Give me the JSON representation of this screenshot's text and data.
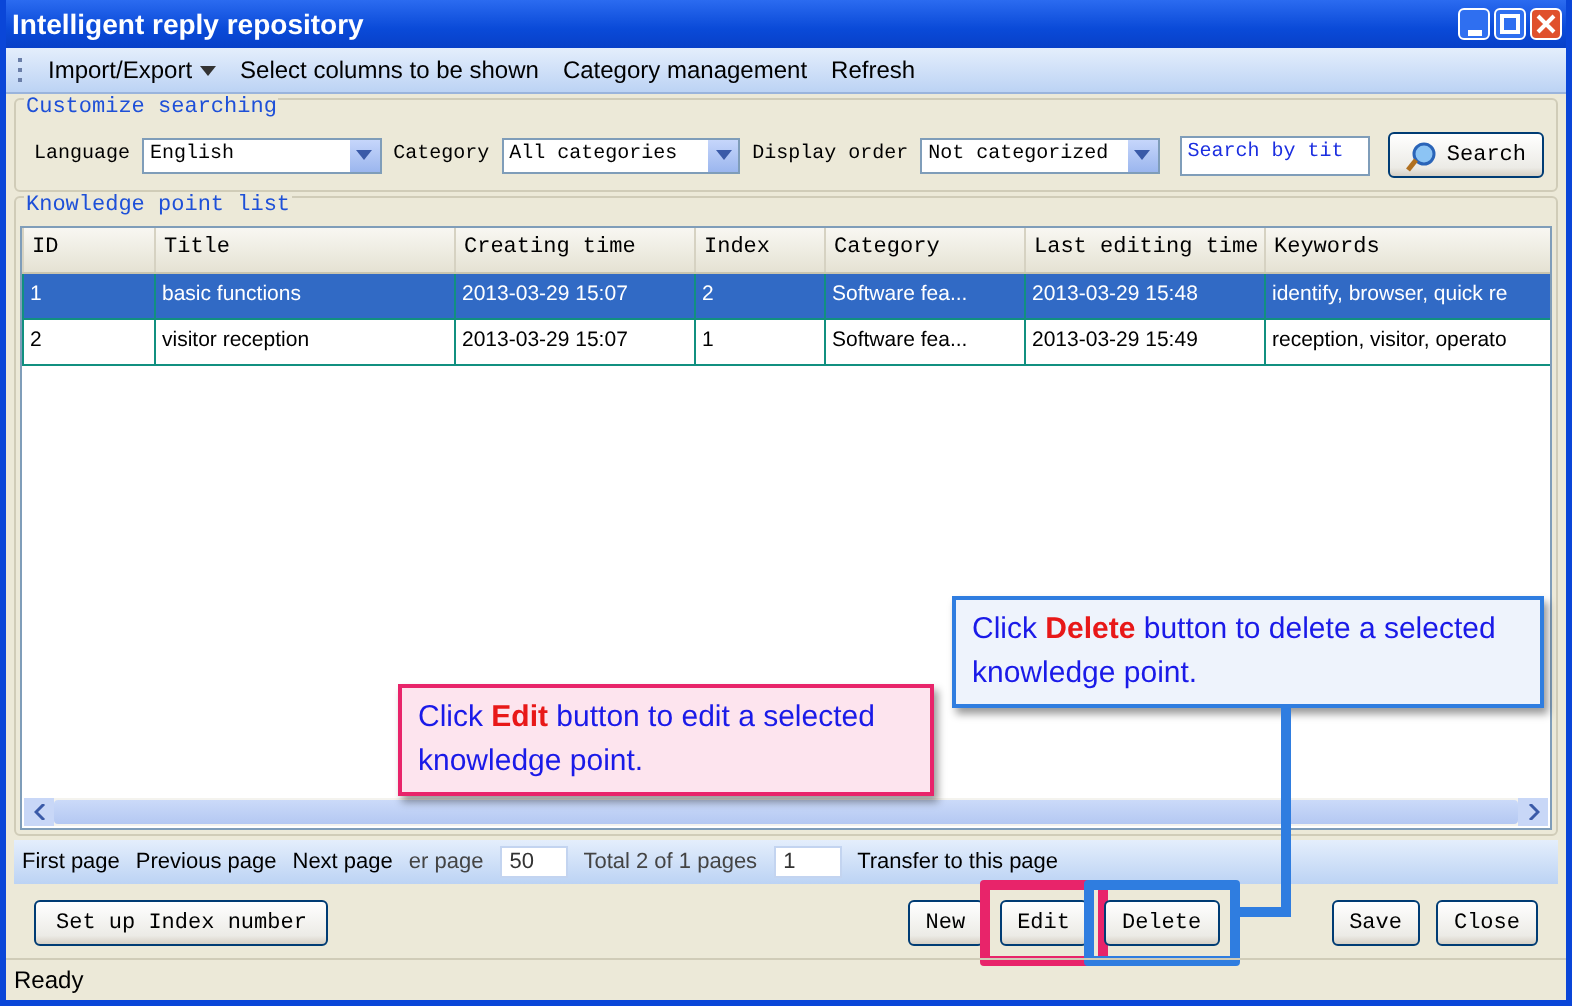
{
  "window": {
    "title": "Intelligent reply repository"
  },
  "toolbar": [
    {
      "label": "Import/Export",
      "kind": "dropdown"
    },
    {
      "label": "Select columns to be shown",
      "kind": "plain"
    },
    {
      "label": "Category management",
      "kind": "plain"
    },
    {
      "label": "Refresh",
      "kind": "plain"
    }
  ],
  "search": {
    "group_title": "Customize searching",
    "filters": [
      {
        "label": "Language",
        "value": "English"
      },
      {
        "label": "Category",
        "value": "All categories"
      },
      {
        "label": "Display order",
        "value": "Not categorized"
      }
    ],
    "query": {
      "value": "Search by tit"
    },
    "button": "Search"
  },
  "list": {
    "group_title": "Knowledge point list",
    "columns": [
      "ID",
      "Title",
      "Creating time",
      "Index",
      "Category",
      "Last editing time",
      "Keywords"
    ],
    "rows": [
      {
        "selected": true,
        "cells": [
          "1",
          "basic functions",
          "2013-03-29 15:07",
          "2",
          "Software fea...",
          "2013-03-29 15:48",
          "identify, browser, quick re"
        ]
      },
      {
        "selected": false,
        "cells": [
          "2",
          "visitor reception",
          "2013-03-29 15:07",
          "1",
          "Software fea...",
          "2013-03-29 15:49",
          "reception, visitor, operato"
        ]
      }
    ]
  },
  "pagination": [
    {
      "kind": "link",
      "text": "First page"
    },
    {
      "kind": "link",
      "text": "Previous page"
    },
    {
      "kind": "link",
      "text": "Next page"
    },
    {
      "kind": "label",
      "text": "er page"
    },
    {
      "kind": "input",
      "text": "50"
    },
    {
      "kind": "label",
      "text": "Total 2 of 1 pages"
    },
    {
      "kind": "input",
      "text": "1"
    },
    {
      "kind": "link",
      "text": "Transfer to this page"
    }
  ],
  "left_button": "Set up Index number",
  "buttons": [
    {
      "label": "New"
    },
    {
      "label": "Edit",
      "color": "#e8246a"
    },
    {
      "label": "Delete",
      "color": "#2f7de0"
    },
    {
      "label": "Save"
    },
    {
      "label": "Close"
    }
  ],
  "status_bar": "Ready",
  "callouts": [
    {
      "before": "Click ",
      "keyword": "Edit",
      "after": " button to edit a selected knowledge point.",
      "color": "#e8246a"
    },
    {
      "before": "Click ",
      "keyword": "Delete",
      "after": " button to delete a selected knowledge point.",
      "color": "#2f7de0"
    }
  ]
}
